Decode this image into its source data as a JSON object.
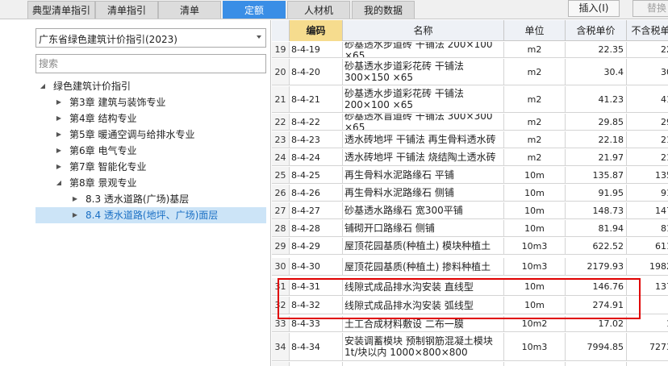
{
  "tabs": [
    {
      "label": "典型清单指引"
    },
    {
      "label": "清单指引"
    },
    {
      "label": "清单"
    },
    {
      "label": "定额"
    },
    {
      "label": "人材机"
    },
    {
      "label": "我的数据"
    }
  ],
  "toolbar": {
    "insert_label": "插入(I)",
    "replace_label": "替换"
  },
  "library": {
    "selected": "广东省绿色建筑计价指引(2023)"
  },
  "search": {
    "placeholder": "搜索"
  },
  "tree": [
    {
      "label": "绿色建筑计价指引"
    },
    {
      "label": "第3章 建筑与装饰专业"
    },
    {
      "label": "第4章 结构专业"
    },
    {
      "label": "第5章 暖通空调与给排水专业"
    },
    {
      "label": "第6章 电气专业"
    },
    {
      "label": "第7章 智能化专业"
    },
    {
      "label": "第8章 景观专业"
    },
    {
      "label": "8.3 透水道路(广场)基层"
    },
    {
      "label": "8.4 透水道路(地坪、广场)面层"
    }
  ],
  "table": {
    "columns": [
      "编码",
      "名称",
      "单位",
      "含税单价",
      "不含税单"
    ],
    "rows": [
      {
        "idx": "19",
        "code": "8-4-19",
        "name": "砂基透水步道砖 干铺法 200×100 ×65",
        "unit": "m2",
        "price": "22.35",
        "notax": "22"
      },
      {
        "idx": "20",
        "code": "8-4-20",
        "name": "砂基透水步道彩花砖 干铺法 300×150 ×65",
        "unit": "m2",
        "price": "30.4",
        "notax": "30"
      },
      {
        "idx": "21",
        "code": "8-4-21",
        "name": "砂基透水步道彩花砖 干铺法 200×100 ×65",
        "unit": "m2",
        "price": "41.23",
        "notax": "41"
      },
      {
        "idx": "22",
        "code": "8-4-22",
        "name": "砂基透水盲道砖 干铺法 300×300 ×65",
        "unit": "m2",
        "price": "29.85",
        "notax": "29"
      },
      {
        "idx": "23",
        "code": "8-4-23",
        "name": "透水砖地坪 干铺法 再生骨料透水砖",
        "unit": "m2",
        "price": "22.18",
        "notax": "21"
      },
      {
        "idx": "24",
        "code": "8-4-24",
        "name": "透水砖地坪 干铺法 烧结陶土透水砖",
        "unit": "m2",
        "price": "21.97",
        "notax": "21"
      },
      {
        "idx": "25",
        "code": "8-4-25",
        "name": "再生骨料水泥路缘石 平铺",
        "unit": "10m",
        "price": "135.87",
        "notax": "135"
      },
      {
        "idx": "26",
        "code": "8-4-26",
        "name": "再生骨料水泥路缘石 侧铺",
        "unit": "10m",
        "price": "91.95",
        "notax": "91"
      },
      {
        "idx": "27",
        "code": "8-4-27",
        "name": "砂基透水路缘石 宽300平铺",
        "unit": "10m",
        "price": "148.73",
        "notax": "147"
      },
      {
        "idx": "28",
        "code": "8-4-28",
        "name": "铺砌开口路缘石 侧铺",
        "unit": "10m",
        "price": "81.94",
        "notax": "81"
      },
      {
        "idx": "29",
        "code": "8-4-29",
        "name": "屋顶花园基质(种植土) 模块种植土",
        "unit": "10m3",
        "price": "622.52",
        "notax": "611"
      },
      {
        "idx": "30",
        "code": "8-4-30",
        "name": "屋顶花园基质(种植土) 掺料种植土",
        "unit": "10m3",
        "price": "2179.93",
        "notax": "1982"
      },
      {
        "idx": "31",
        "code": "8-4-31",
        "name": "线隙式成品排水沟安装 直线型",
        "unit": "10m",
        "price": "146.76",
        "notax": "137"
      },
      {
        "idx": "32",
        "code": "8-4-32",
        "name": "线隙式成品排水沟安装 弧线型",
        "unit": "10m",
        "price": "274.91",
        "notax": ""
      },
      {
        "idx": "33",
        "code": "8-4-33",
        "name": "土工合成材料敷设 二布一膜",
        "unit": "10m2",
        "price": "17.02",
        "notax": "1"
      },
      {
        "idx": "34",
        "code": "8-4-34",
        "name": "安装调蓄模块 预制钢筋混凝土模块 1t/块以内 1000×800×800",
        "unit": "10m3",
        "price": "7994.85",
        "notax": "7273"
      }
    ]
  }
}
